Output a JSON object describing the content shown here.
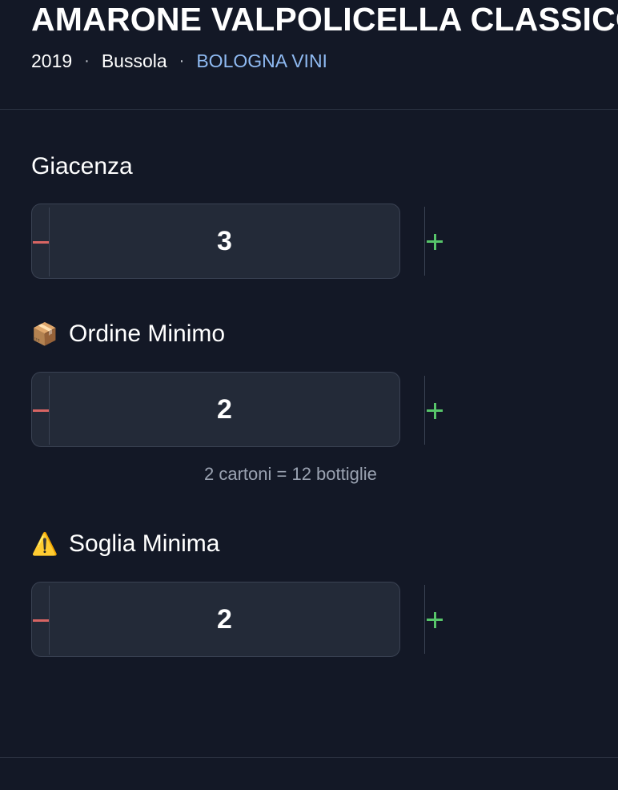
{
  "header": {
    "title": "AMARONE VALPOLICELLA CLASSICO",
    "year": "2019",
    "producer": "Bussola",
    "supplier": "BOLOGNA VINI",
    "separator": "·"
  },
  "fields": [
    {
      "label": "Giacenza",
      "emoji": "",
      "value": "3",
      "minus_icon": "minus-icon",
      "plus_icon": "plus-icon"
    },
    {
      "label": "Ordine Minimo",
      "emoji": "📦",
      "value": "2",
      "helper": "2 cartoni = 12 bottiglie",
      "minus_icon": "minus-icon",
      "plus_icon": "plus-icon"
    },
    {
      "label": "Soglia Minima",
      "emoji": "⚠️",
      "value": "2",
      "minus_icon": "minus-icon",
      "plus_icon": "plus-icon"
    }
  ],
  "colors": {
    "background": "#131826",
    "field_background": "#232a38",
    "minus": "#d86563",
    "plus": "#57c56a",
    "supplier_link": "#8fbaf2",
    "helper_text": "#9aa2b1"
  }
}
